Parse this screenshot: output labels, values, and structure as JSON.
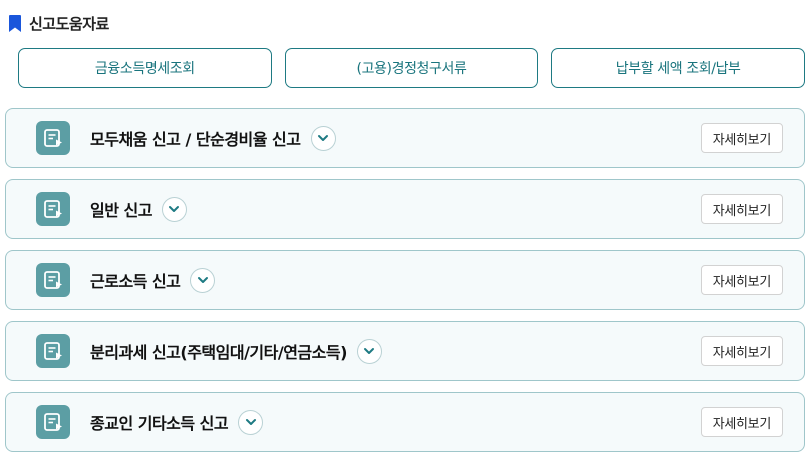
{
  "header": {
    "title": "신고도움자료"
  },
  "quick_links": [
    "금융소득명세조회",
    "(고용)경정청구서류",
    "납부할 세액 조회/납부"
  ],
  "cards": [
    {
      "title": "모두채움 신고 / 단순경비율 신고",
      "detail_label": "자세히보기"
    },
    {
      "title": "일반 신고",
      "detail_label": "자세히보기"
    },
    {
      "title": "근로소득 신고",
      "detail_label": "자세히보기"
    },
    {
      "title": "분리과세 신고(주택임대/기타/연금소득)",
      "detail_label": "자세히보기"
    },
    {
      "title": "종교인 기타소득 신고",
      "detail_label": "자세히보기"
    }
  ],
  "colors": {
    "accent": "#1e7a83",
    "bookmark": "#1a56db",
    "card_bg": "#f5fafb",
    "icon_bg": "#5c9ea4"
  },
  "icons": {
    "bookmark": "bookmark-icon",
    "card": "document-icon",
    "expand": "chevron-down-icon"
  }
}
